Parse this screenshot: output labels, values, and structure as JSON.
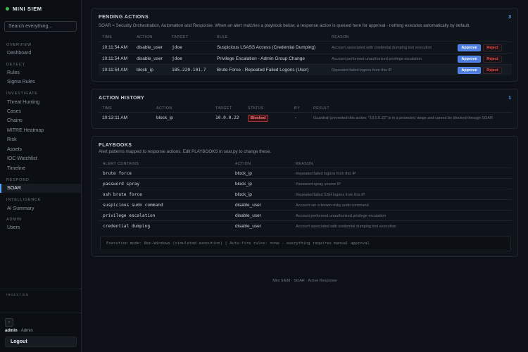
{
  "sidebar": {
    "brand": "MINI SIEM",
    "search_placeholder": "Search everything...",
    "sections": {
      "overview": "OVERVIEW",
      "detect": "DETECT",
      "investigate": "INVESTIGATE",
      "respond": "RESPOND",
      "intelligence": "INTELLIGENCE",
      "admin": "ADMIN"
    },
    "items": {
      "dashboard": "Dashboard",
      "rules": "Rules",
      "sigma_rules": "Sigma Rules",
      "threat_hunting": "Threat Hunting",
      "cases": "Cases",
      "chains": "Chains",
      "mitre_heatmap": "MITRE Heatmap",
      "risk": "Risk",
      "assets": "Assets",
      "ioc_watchlist": "IOC Watchlist",
      "timeline": "Timeline",
      "soar": "SOAR",
      "ai_summary": "AI Summary",
      "users": "Users"
    },
    "ingestion_label": "INGESTION",
    "user": {
      "name": "admin",
      "role": "Admin"
    },
    "logout_label": "Logout",
    "small_button_icon": "chevron-right-icon"
  },
  "pending": {
    "title": "PENDING ACTIONS",
    "count": "3",
    "description": "SOAR = Security Orchestration, Automation and Response. When an alert matches a playbook below, a response action is queued here for approval - nothing executes automatically by default.",
    "headers": {
      "time": "TIME",
      "action": "ACTION",
      "target": "TARGET",
      "rule": "RULE",
      "reason": "REASON"
    },
    "approve_label": "Approve",
    "reject_label": "Reject",
    "rows": [
      {
        "time": "10:11:54 AM",
        "action": "disable_user",
        "target": "jdoe",
        "rule": "Suspicious LSASS Access (Credential Dumping)",
        "reason": "Account associated with credential dumping tool execution"
      },
      {
        "time": "10:11:54 AM",
        "action": "disable_user",
        "target": "jdoe",
        "rule": "Privilege Escalation - Admin Group Change",
        "reason": "Account performed unauthorized privilege escalation"
      },
      {
        "time": "10:11:54 AM",
        "action": "block_ip",
        "target": "185.220.101.7",
        "rule": "Brute Force - Repeated Failed Logons (User)",
        "reason": "Repeated failed logons from this IP"
      }
    ]
  },
  "history": {
    "title": "ACTION HISTORY",
    "count": "1",
    "headers": {
      "time": "TIME",
      "action": "ACTION",
      "target": "TARGET",
      "status": "STATUS",
      "by": "BY",
      "result": "RESULT"
    },
    "rows": [
      {
        "time": "10:13:11 AM",
        "action": "block_ip",
        "target": "10.0.0.22",
        "status": "Blocked",
        "by": "-",
        "result": "Guardrail prevented this action: \"10.0.0.22\" is in a protected range and cannot be blocked through SOAR"
      }
    ]
  },
  "playbooks": {
    "title": "PLAYBOOKS",
    "description": "Alert patterns mapped to response actions. Edit PLAYBOOKS in soar.py to change these.",
    "headers": {
      "alert_contains": "ALERT CONTAINS",
      "action": "ACTION",
      "reason": "REASON"
    },
    "rows": [
      {
        "pattern": "brute force",
        "action": "block_ip",
        "reason": "Repeated failed logons from this IP"
      },
      {
        "pattern": "password spray",
        "action": "block_ip",
        "reason": "Password spray source IP"
      },
      {
        "pattern": "ssh brute force",
        "action": "block_ip",
        "reason": "Repeated failed SSH logons from this IP"
      },
      {
        "pattern": "suspicious sudo command",
        "action": "disable_user",
        "reason": "Account ran a known-risky sudo command"
      },
      {
        "pattern": "privilege escalation",
        "action": "disable_user",
        "reason": "Account performed unauthorized privilege escalation"
      },
      {
        "pattern": "credential dumping",
        "action": "disable_user",
        "reason": "Account associated with credential dumping tool execution"
      }
    ],
    "execution_note": "Execution mode: Non-Windows (simulated execution) | Auto-fire rules: none - everything requires manual approval"
  },
  "footer": "Mini SIEM · SOAR · Active Response",
  "colors": {
    "accent": "#58a6ff",
    "approve": "#4c7fe0",
    "reject": "#f85149",
    "online": "#3fb950",
    "background": "#0d1117"
  }
}
